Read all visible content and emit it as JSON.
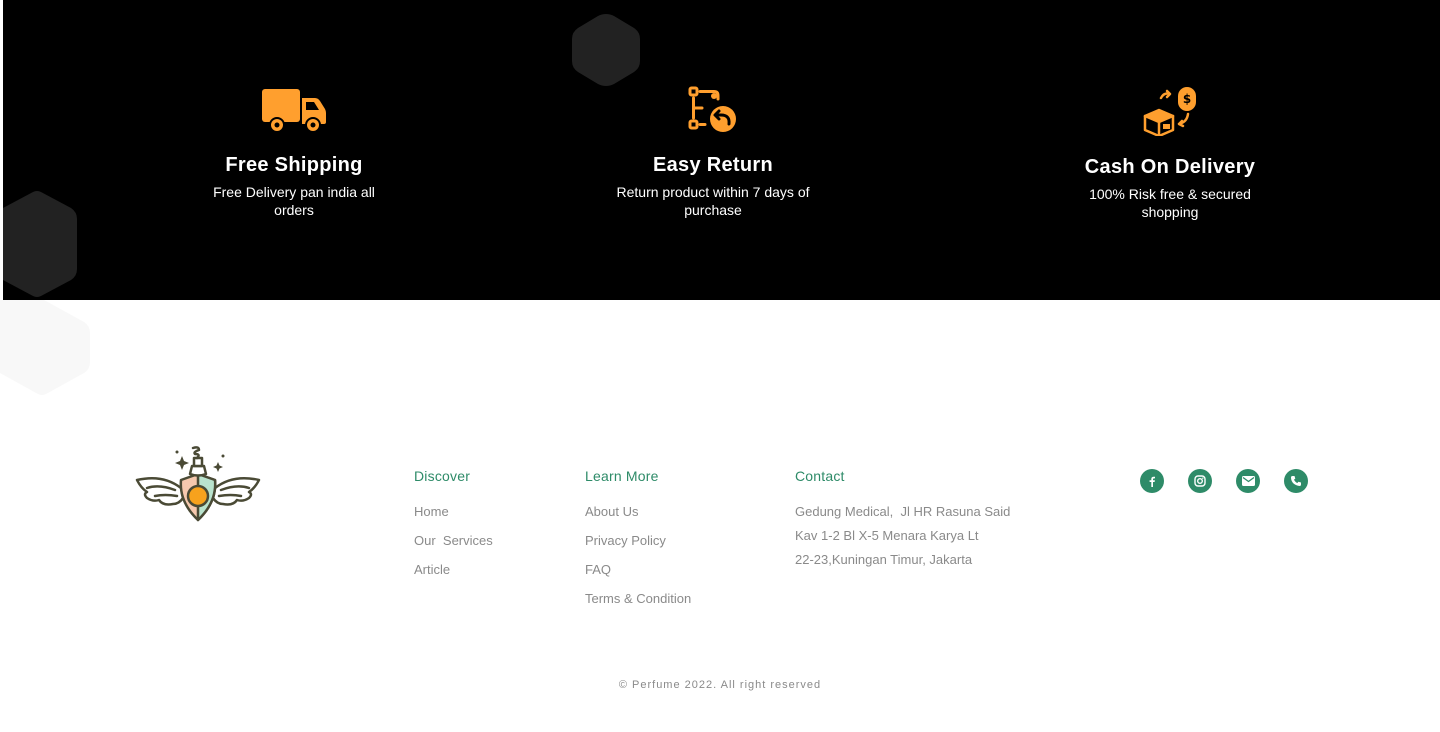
{
  "features": [
    {
      "icon": "truck-icon",
      "title": "Free Shipping",
      "desc": "Free Delivery pan india all orders"
    },
    {
      "icon": "return-icon",
      "title": "Easy Return",
      "desc": "Return product within 7 days of purchase"
    },
    {
      "icon": "cash-on-delivery-icon",
      "title": "Cash On Delivery",
      "desc": "100% Risk free & secured shopping"
    }
  ],
  "colors": {
    "accent": "#ff9f2e",
    "brand": "#2e8b68",
    "muted": "#8a8a8a",
    "band": "#000000"
  },
  "footer": {
    "discover": {
      "heading": "Discover",
      "links": [
        "Home",
        "Our  Services",
        "Article"
      ]
    },
    "learn_more": {
      "heading": "Learn More",
      "links": [
        "About Us",
        "Privacy Policy",
        "FAQ",
        "Terms & Condition"
      ]
    },
    "contact": {
      "heading": "Contact",
      "lines": [
        "Gedung Medical,  Jl HR Rasuna Said",
        "Kav 1-2 Bl X-5 Menara Karya Lt",
        "22-23,Kuningan Timur, Jakarta"
      ]
    },
    "socials": [
      "facebook-icon",
      "instagram-icon",
      "mail-icon",
      "phone-icon"
    ],
    "copyright_symbol": "©",
    "copyright": "Perfume 2022. All right reserved"
  }
}
